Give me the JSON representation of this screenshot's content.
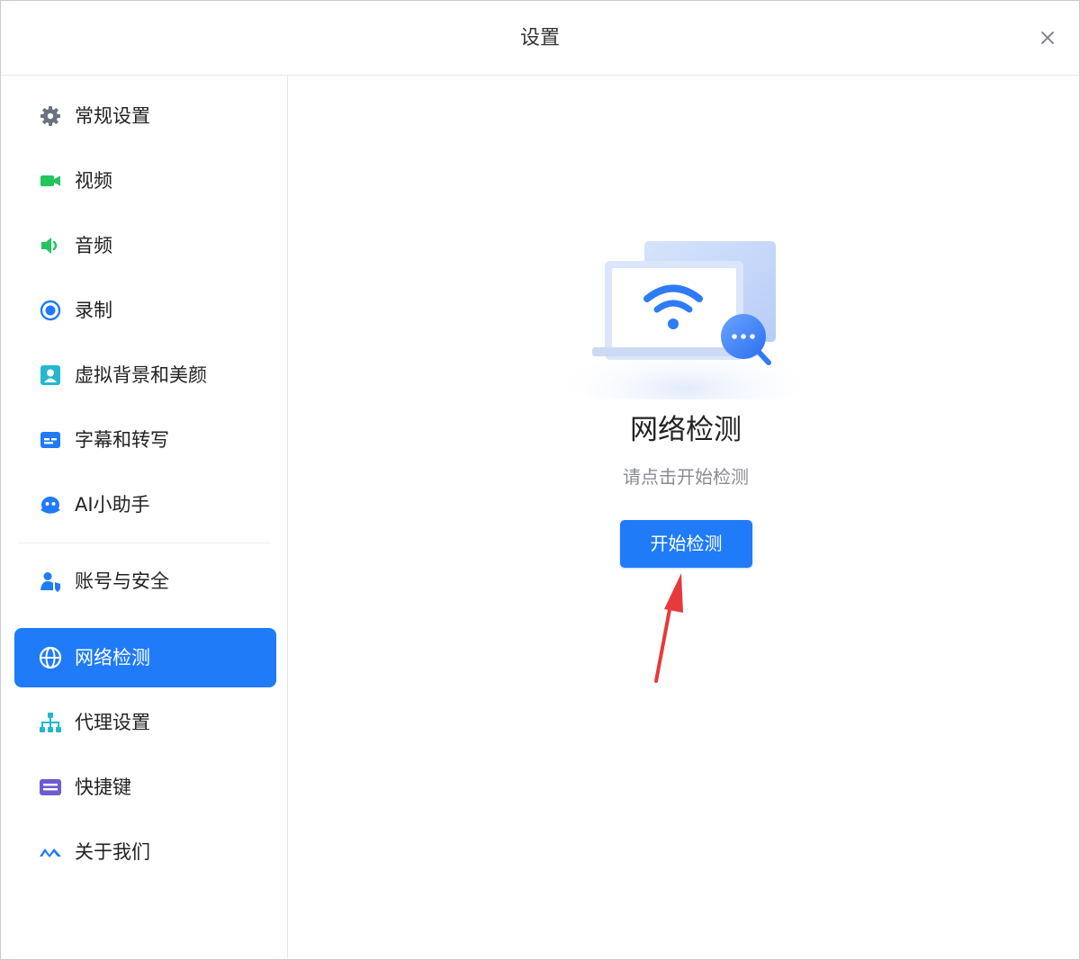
{
  "window": {
    "title": "设置"
  },
  "sidebar": {
    "items": [
      {
        "label": "常规设置",
        "icon": "gear-icon",
        "color": "#6b7280"
      },
      {
        "label": "视频",
        "icon": "video-camera-icon",
        "color": "#22c55e"
      },
      {
        "label": "音频",
        "icon": "speaker-icon",
        "color": "#22c55e"
      },
      {
        "label": "录制",
        "icon": "record-icon",
        "color": "#1f7bf8"
      },
      {
        "label": "虚拟背景和美颜",
        "icon": "portrait-icon",
        "color": "#22b8cf"
      },
      {
        "label": "字幕和转写",
        "icon": "subtitles-icon",
        "color": "#1f7bf8"
      },
      {
        "label": "AI小助手",
        "icon": "robot-icon",
        "color": "#1f7bf8"
      },
      {
        "label": "账号与安全",
        "icon": "user-shield-icon",
        "color": "#1f7bf8"
      },
      {
        "label": "网络检测",
        "icon": "globe-icon",
        "color": "#ffffff",
        "active": true
      },
      {
        "label": "代理设置",
        "icon": "network-tree-icon",
        "color": "#22b8cf"
      },
      {
        "label": "快捷键",
        "icon": "keyboard-icon",
        "color": "#6d5bd0"
      },
      {
        "label": "关于我们",
        "icon": "logo-icon",
        "color": "#1f7bf8"
      }
    ]
  },
  "main": {
    "heading": "网络检测",
    "subtitle": "请点击开始检测",
    "start_button": "开始检测"
  },
  "colors": {
    "accent": "#1f7bf8",
    "annotation_arrow": "#e8393b"
  }
}
